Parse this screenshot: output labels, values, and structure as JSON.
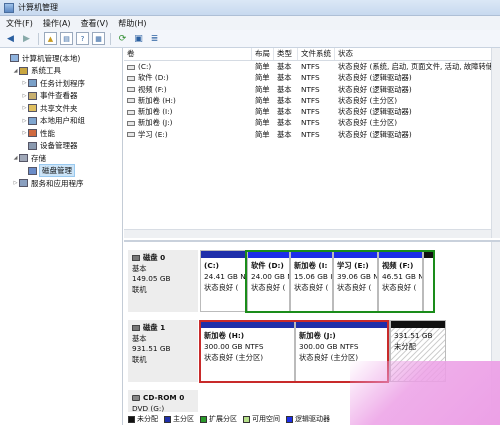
{
  "window": {
    "title": "计算机管理"
  },
  "menu": [
    "文件(F)",
    "操作(A)",
    "查看(V)",
    "帮助(H)"
  ],
  "tree": [
    {
      "label": "计算机管理(本地)",
      "level": 0,
      "expander": "",
      "icon": "computer-icon"
    },
    {
      "label": "系统工具",
      "level": 1,
      "expander": "◢",
      "icon": "tools-icon"
    },
    {
      "label": "任务计划程序",
      "level": 2,
      "expander": "▷",
      "icon": "clock-icon"
    },
    {
      "label": "事件查看器",
      "level": 2,
      "expander": "▷",
      "icon": "event-viewer-icon"
    },
    {
      "label": "共享文件夹",
      "level": 2,
      "expander": "▷",
      "icon": "shared-folder-icon"
    },
    {
      "label": "本地用户和组",
      "level": 2,
      "expander": "▷",
      "icon": "users-icon"
    },
    {
      "label": "性能",
      "level": 2,
      "expander": "▷",
      "icon": "performance-icon"
    },
    {
      "label": "设备管理器",
      "level": 2,
      "expander": "",
      "icon": "device-manager-icon"
    },
    {
      "label": "存储",
      "level": 1,
      "expander": "◢",
      "icon": "storage-icon"
    },
    {
      "label": "磁盘管理",
      "level": 2,
      "expander": "",
      "icon": "disk-management-icon",
      "selected": true
    },
    {
      "label": "服务和应用程序",
      "level": 1,
      "expander": "▷",
      "icon": "services-icon"
    }
  ],
  "columns": [
    "卷",
    "布局",
    "类型",
    "文件系统",
    "状态"
  ],
  "volumes": [
    [
      "(C:)",
      "简单",
      "基本",
      "NTFS",
      "状态良好 (系统, 启动, 页面文件, 活动, 故障转储"
    ],
    [
      "软件 (D:)",
      "简单",
      "基本",
      "NTFS",
      "状态良好 (逻辑驱动器)"
    ],
    [
      "视频 (F:)",
      "简单",
      "基本",
      "NTFS",
      "状态良好 (逻辑驱动器)"
    ],
    [
      "新加卷 (H:)",
      "简单",
      "基本",
      "NTFS",
      "状态良好 (主分区)"
    ],
    [
      "新加卷 (I:)",
      "简单",
      "基本",
      "NTFS",
      "状态良好 (逻辑驱动器)"
    ],
    [
      "新加卷 (J:)",
      "简单",
      "基本",
      "NTFS",
      "状态良好 (主分区)"
    ],
    [
      "学习 (E:)",
      "简单",
      "基本",
      "NTFS",
      "状态良好 (逻辑驱动器)"
    ]
  ],
  "disks": [
    {
      "name": "磁盘 0",
      "type": "基本",
      "size": "149.05 GB",
      "status": "联机",
      "partitions": [
        {
          "label": "(C:)",
          "size": "24.41 GB N",
          "status": "状态良好 (",
          "bar": "primary"
        },
        {
          "label": "软件 (D:)",
          "size": "24.00 GB N",
          "status": "状态良好 (",
          "bar": "logical"
        },
        {
          "label": "新加卷 (I:",
          "size": "15.06 GB I",
          "status": "状态良好 (",
          "bar": "logical"
        },
        {
          "label": "学习 (E:)",
          "size": "39.06 GB N",
          "status": "状态良好 (",
          "bar": "logical"
        },
        {
          "label": "视频 (F:)",
          "size": "46.51 GB N",
          "status": "状态良好 (",
          "bar": "logical"
        },
        {
          "label": "",
          "size": "",
          "status": "",
          "bar": "black"
        }
      ]
    },
    {
      "name": "磁盘 1",
      "type": "基本",
      "size": "931.51 GB",
      "status": "联机",
      "partitions": [
        {
          "label": "新加卷 (H:)",
          "size": "300.00 GB NTFS",
          "status": "状态良好 (主分区)",
          "bar": "primary"
        },
        {
          "label": "新加卷 (J:)",
          "size": "300.00 GB NTFS",
          "status": "状态良好 (主分区)",
          "bar": "primary"
        },
        {
          "label": "",
          "size": "331.51 GB",
          "status": "未分配",
          "bar": "black"
        }
      ]
    },
    {
      "name": "CD-ROM 0",
      "type": "DVD (G:)",
      "size": "",
      "status": ""
    }
  ],
  "legend": [
    {
      "label": "未分配",
      "color": "#111111"
    },
    {
      "label": "主分区",
      "color": "#1f2faa"
    },
    {
      "label": "扩展分区",
      "color": "#2a9a2a"
    },
    {
      "label": "可用空间",
      "color": "#b6e08a"
    },
    {
      "label": "逻辑驱动器",
      "color": "#1d2ee8"
    }
  ]
}
